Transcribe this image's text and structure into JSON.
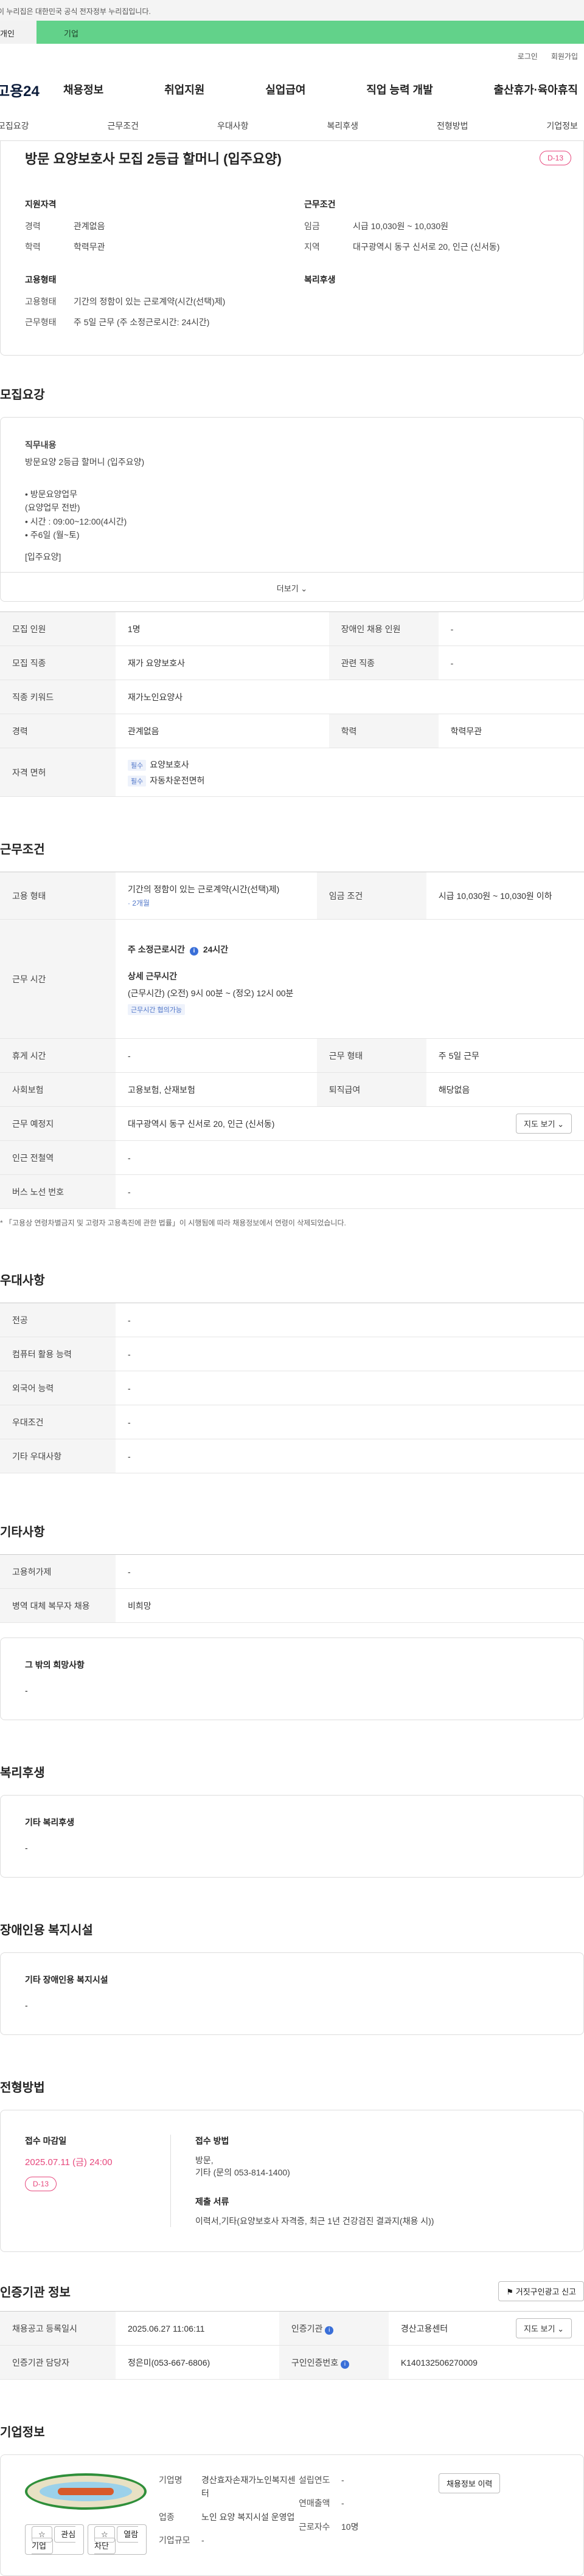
{
  "gov_banner": "이 누리집은 대한민국 공식 전자정부 누리집입니다.",
  "user_tabs": {
    "individual": "개인",
    "business": "기업"
  },
  "topbar": {
    "login": "로그인",
    "signup": "회원가입"
  },
  "gnb": {
    "logo": "고용24",
    "menu": [
      "채용정보",
      "취업지원",
      "실업급여",
      "직업 능력 개발",
      "출산휴가·육아휴직"
    ]
  },
  "subnav": [
    "모집요강",
    "근무조건",
    "우대사항",
    "복리후생",
    "전형방법",
    "기업정보"
  ],
  "summary": {
    "title": "방문 요양보호사 모집 2등급 할머니 (입주요양)",
    "dday": "D-13",
    "qualification": {
      "heading": "지원자격",
      "career_k": "경력",
      "career_v": "관계없음",
      "edu_k": "학력",
      "edu_v": "학력무관"
    },
    "conditions": {
      "heading": "근무조건",
      "wage_k": "임금",
      "wage_v": "시급 10,030원 ~ 10,030원",
      "area_k": "지역",
      "area_v": "대구광역시 동구 신서로 20, 인근 (신서동)"
    },
    "employment": {
      "heading": "고용형태",
      "type_k": "고용형태",
      "type_v": "기간의 정함이 있는 근로계약(시간(선택)제)",
      "form_k": "근무형태",
      "form_v": "주 5일 근무 (주 소정근로시간: 24시간)"
    },
    "welfare": {
      "heading": "복리후생"
    }
  },
  "recruit": {
    "section_title": "모집요강",
    "job_desc_heading": "직무내용",
    "job_desc_title": "방문요양 2등급 할머니 (입주요양)",
    "job_desc_lines": [
      "• 방문요양업무",
      "(요양업무 전반)",
      "• 시간 : 09:00~12:00(4시간)",
      "• 주6일 (월~토)",
      "[입주요양]"
    ],
    "more": "더보기",
    "rows": {
      "headcount_k": "모집 인원",
      "headcount_v": "1명",
      "disabled_k": "장애인 채용 인원",
      "disabled_v": "-",
      "job_k": "모집 직종",
      "job_v": "재가 요양보호사",
      "related_k": "관련 직종",
      "related_v": "-",
      "keyword_k": "직종 키워드",
      "keyword_v": "재가노인요양사",
      "career_k": "경력",
      "career_v": "관계없음",
      "edu_k": "학력",
      "edu_v": "학력무관",
      "license_k": "자격 면허",
      "license_tag": "필수",
      "license_1": "요양보호사",
      "license_2": "자동차운전면허"
    }
  },
  "work": {
    "section_title": "근무조건",
    "type_k": "고용 형태",
    "type_v": "기간의 정함이 있는 근로계약(시간(선택)제)",
    "type_sub": "· 2개월",
    "wage_k": "임금 조건",
    "wage_v": "시급 10,030원 ~ 10,030원 이하",
    "hours_k": "근무 시간",
    "weekly_hours_label": "주 소정근로시간",
    "weekly_hours_value": "24시간",
    "detail_label": "상세 근무시간",
    "detail_value": "(근무시간) (오전) 9시 00분 ~ (정오) 12시 00분",
    "flex_tag": "근무시간 협의가능",
    "break_k": "휴게 시간",
    "break_v": "-",
    "form_k": "근무 형태",
    "form_v": "주 5일 근무",
    "insurance_k": "사회보험",
    "insurance_v": "고용보험, 산재보험",
    "retire_k": "퇴직급여",
    "retire_v": "해당없음",
    "place_k": "근무 예정지",
    "place_v": "대구광역시 동구 신서로 20, 인근 (신서동)",
    "map_btn": "지도 보기",
    "station_k": "인근 전철역",
    "station_v": "-",
    "bus_k": "버스 노선 번호",
    "bus_v": "-",
    "note": "* 「고용상 연령차별금지 및 고령자 고용촉진에 관한 법률」이 시행됨에 따라 채용정보에서 연령이 삭제되었습니다."
  },
  "prefer": {
    "section_title": "우대사항",
    "rows": [
      {
        "k": "전공",
        "v": "-"
      },
      {
        "k": "컴퓨터 활용 능력",
        "v": "-"
      },
      {
        "k": "외국어 능력",
        "v": "-"
      },
      {
        "k": "우대조건",
        "v": "-"
      },
      {
        "k": "기타 우대사항",
        "v": "-"
      }
    ]
  },
  "etc": {
    "section_title": "기타사항",
    "rows": [
      {
        "k": "고용허가제",
        "v": "-"
      },
      {
        "k": "병역 대체 복무자 채용",
        "v": "비희망"
      }
    ],
    "wish_heading": "그 밖의 희망사항",
    "wish_value": "-"
  },
  "welfare": {
    "section_title": "복리후생",
    "heading": "기타 복리후생",
    "value": "-"
  },
  "disability": {
    "section_title": "장애인용 복지시설",
    "heading": "기타 장애인용 복지시설",
    "value": "-"
  },
  "selection": {
    "section_title": "전형방법",
    "deadline_label": "접수 마감일",
    "deadline_value": "2025.07.11 (금) 24:00",
    "dday": "D-13",
    "method_label": "접수 방법",
    "method_value_1": "방문,",
    "method_value_2": "기타 (문의 053-814-1400)",
    "docs_label": "제출 서류",
    "docs_value": "이력서,기타(요양보호사 자격증, 최근 1년 건강검진 결과지(채용 시))"
  },
  "cert": {
    "section_title": "인증기관 정보",
    "report_btn": "거짓구인광고 신고",
    "reg_k": "채용공고 등록일시",
    "reg_v": "2025.06.27 11:06:11",
    "org_k": "인증기관",
    "org_v": "경산고용센터",
    "map_btn": "지도 보기",
    "manager_k": "인증기관 담당자",
    "manager_v": "정은미(053-667-6806)",
    "auth_k": "구인인증번호",
    "auth_v": "K140132506270009"
  },
  "company": {
    "section_title": "기업정보",
    "fav_btn": "관심기업",
    "hist_btn": "열람차단",
    "name_k": "기업명",
    "name_v": "경산효자손재가노인복지센터",
    "industry_k": "업종",
    "industry_v": "노인 요양 복지시설 운영업",
    "size_k": "기업규모",
    "size_v": "-",
    "founded_k": "설립연도",
    "founded_v": "-",
    "revenue_k": "연매출액",
    "revenue_v": "-",
    "employees_k": "근로자수",
    "employees_v": "10명",
    "jobs_btn": "채용정보 이력"
  }
}
